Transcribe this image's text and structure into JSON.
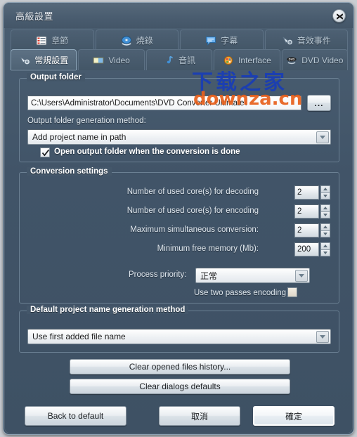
{
  "window": {
    "title": "高級設置",
    "close_icon": "close-icon"
  },
  "tabs": {
    "row1": [
      {
        "label": "章節",
        "icon": "chapter-icon",
        "active": false
      },
      {
        "label": "燒錄",
        "icon": "burn-disc-icon",
        "active": false
      },
      {
        "label": "字幕",
        "icon": "subtitle-icon",
        "active": false
      },
      {
        "label": "音效事件",
        "icon": "audio-event-icon",
        "active": false
      }
    ],
    "row2": [
      {
        "label": "常規設置",
        "icon": "general-settings-icon",
        "active": true
      },
      {
        "label": "Video",
        "icon": "video-icon",
        "active": false
      },
      {
        "label": "音訊",
        "icon": "audio-icon",
        "active": false
      },
      {
        "label": "Interface",
        "icon": "interface-icon",
        "active": false
      },
      {
        "label": "DVD Video",
        "icon": "dvd-video-icon",
        "active": false
      }
    ]
  },
  "output_folder": {
    "group_title": "Output folder",
    "path_value": "C:\\Users\\Administrator\\Documents\\DVD Converter Ultimate\\",
    "browse_label": "...",
    "generation_method_label": "Output folder generation method:",
    "generation_method_value": "Add project name in path",
    "open_folder_checkbox_label": "Open output folder when the conversion is done",
    "open_folder_checked": true
  },
  "conversion_settings": {
    "group_title": "Conversion settings",
    "rows": [
      {
        "label": "Number of used core(s) for decoding",
        "value": "2"
      },
      {
        "label": "Number of used core(s) for encoding",
        "value": "2"
      },
      {
        "label": "Maximum simultaneous conversion:",
        "value": "2"
      },
      {
        "label": "Minimum free memory (Mb):",
        "value": "200"
      }
    ],
    "priority_label": "Process priority:",
    "priority_value": "正常",
    "two_passes_label": "Use two passes encoding",
    "two_passes_checked": false
  },
  "project_name": {
    "group_title": "Default project name generation method",
    "value": "Use first added file name"
  },
  "actions": {
    "clear_history": "Clear opened files history...",
    "clear_dialogs": "Clear dialogs defaults"
  },
  "footer": {
    "back_to_default": "Back to default",
    "cancel": "取消",
    "ok": "確定"
  },
  "watermark": {
    "cn": "下载之家",
    "en": "downza.cn",
    "cn_color": "#1b3fb5",
    "en_color": "#e8601c"
  },
  "theme": {
    "window_bg": "#44576a",
    "titlebar_bg": "#4a5d70",
    "border": "#8fa3b4",
    "group_border": "#6b8093",
    "text": "#dfe7ee",
    "text_bold": "#ffffff"
  }
}
